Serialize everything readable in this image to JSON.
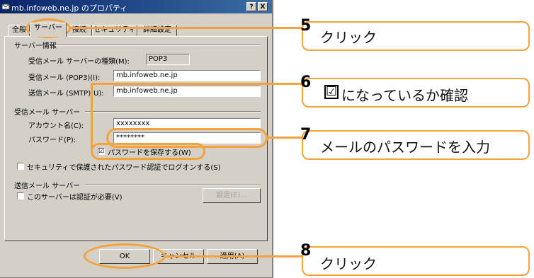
{
  "dialog": {
    "title": "mb.infoweb.ne.jp のプロパティ",
    "help_btn": "?",
    "close_btn": "X",
    "tabs": [
      "全般",
      "サーバー",
      "接続",
      "セキュリティ",
      "詳細設定"
    ],
    "active_tab": "サーバー",
    "server_info": {
      "group": "サーバー情報",
      "incoming_type_label": "受信メール サーバーの種類(M):",
      "incoming_type_value": "POP3",
      "incoming_label": "受信メール (POP3)(I):",
      "incoming_value": "mb.infoweb.ne.jp",
      "outgoing_label": "送信メール (SMTP)(U):",
      "outgoing_value": "mb.infoweb.ne.jp"
    },
    "incoming_server": {
      "group": "受信メール サーバー",
      "account_label": "アカウント名(C):",
      "account_value": "xxxxxxxx",
      "password_label": "パスワード(P):",
      "password_value": "********",
      "remember_label": "パスワードを保存する(W)",
      "remember_checked": "☑",
      "spa_label": "セキュリティで保護されたパスワード認証でログオンする(S)"
    },
    "outgoing_server": {
      "group": "送信メール サーバー",
      "auth_label": "このサーバーは認証が必要(V)",
      "settings_btn": "設定(E)..."
    },
    "buttons": {
      "ok": "OK",
      "cancel": "キャンセル",
      "apply": "適用(A)"
    }
  },
  "callouts": [
    {
      "step": "5",
      "text": "クリック"
    },
    {
      "step": "6",
      "text": "になっているか確認"
    },
    {
      "step": "7",
      "text": "メールのパスワードを入力"
    },
    {
      "step": "8",
      "text": "クリック"
    }
  ],
  "checkmark_glyph": "☑",
  "colors": {
    "accent": "#f3a33a",
    "titlebar": "#0a246a",
    "dialog_bg": "#d4d0c8"
  }
}
